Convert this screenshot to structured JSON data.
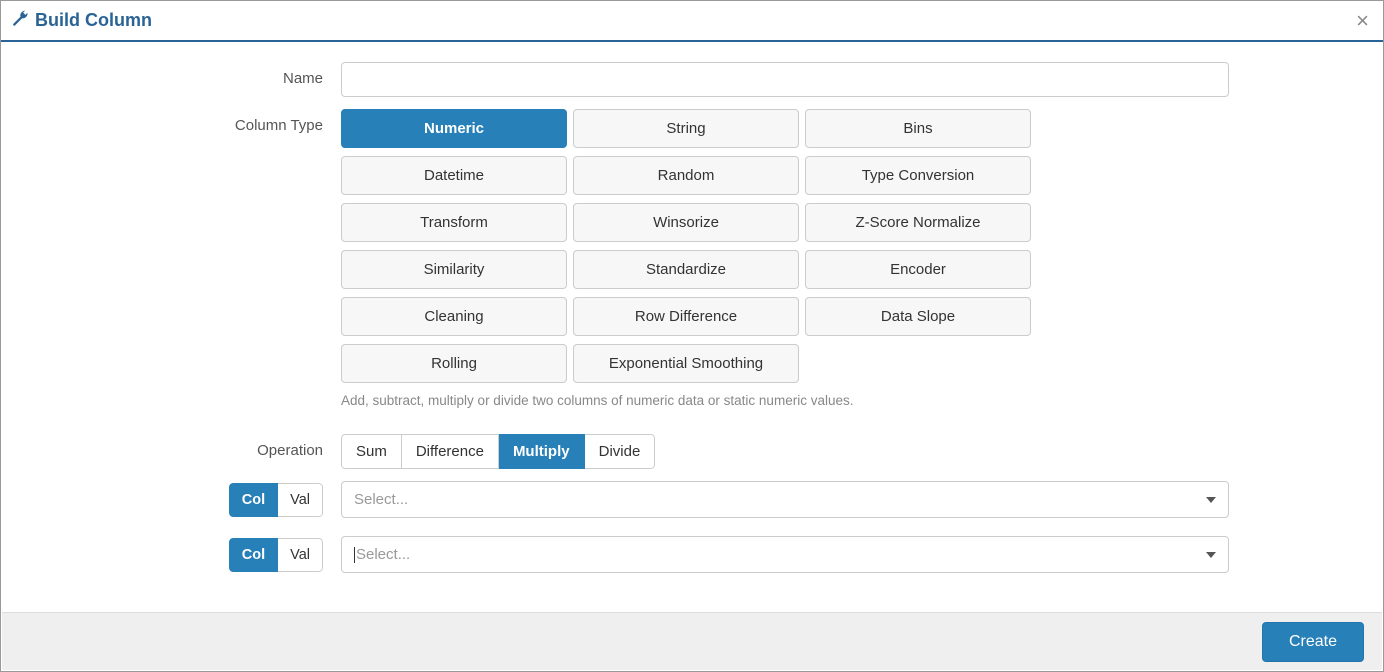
{
  "header": {
    "title": "Build Column",
    "close_label": "×"
  },
  "fields": {
    "name_label": "Name",
    "name_value": "",
    "column_type_label": "Column Type",
    "operation_label": "Operation",
    "help_text": "Add, subtract, multiply or divide two columns of numeric data or static numeric values."
  },
  "column_types": [
    "Numeric",
    "String",
    "Bins",
    "Datetime",
    "Random",
    "Type Conversion",
    "Transform",
    "Winsorize",
    "Z-Score Normalize",
    "Similarity",
    "Standardize",
    "Encoder",
    "Cleaning",
    "Row Difference",
    "Data Slope",
    "Rolling",
    "Exponential Smoothing"
  ],
  "column_type_active": "Numeric",
  "operations": [
    "Sum",
    "Difference",
    "Multiply",
    "Divide"
  ],
  "operation_active": "Multiply",
  "operand_toggle": {
    "col": "Col",
    "val": "Val",
    "active": "Col"
  },
  "select_placeholder": "Select...",
  "footer": {
    "create_label": "Create"
  }
}
